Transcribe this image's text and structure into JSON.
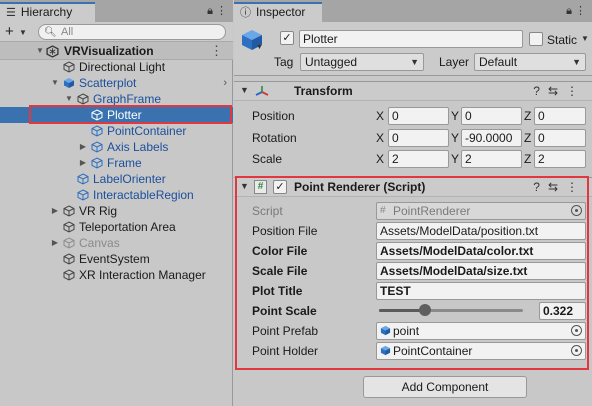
{
  "hierarchy": {
    "tab_label": "Hierarchy",
    "search_placeholder": "All",
    "scene_name": "VRVisualization",
    "items": [
      {
        "label": "Directional Light"
      },
      {
        "label": "Scatterplot"
      },
      {
        "label": "GraphFrame"
      },
      {
        "label": "Plotter"
      },
      {
        "label": "PointContainer"
      },
      {
        "label": "Axis Labels"
      },
      {
        "label": "Frame"
      },
      {
        "label": "LabelOrienter"
      },
      {
        "label": "InteractableRegion"
      },
      {
        "label": "VR Rig"
      },
      {
        "label": "Teleportation Area"
      },
      {
        "label": "Canvas"
      },
      {
        "label": "EventSystem"
      },
      {
        "label": "XR Interaction Manager"
      }
    ]
  },
  "inspector": {
    "tab_label": "Inspector",
    "object_name": "Plotter",
    "static_label": "Static",
    "tag_label": "Tag",
    "tag_value": "Untagged",
    "layer_label": "Layer",
    "layer_value": "Default",
    "transform": {
      "title": "Transform",
      "position_label": "Position",
      "rotation_label": "Rotation",
      "scale_label": "Scale",
      "x": "X",
      "y": "Y",
      "z": "Z",
      "position": [
        "0",
        "0",
        "0"
      ],
      "rotation": [
        "0",
        "-90.0000",
        "0"
      ],
      "scale": [
        "2",
        "2",
        "2"
      ]
    },
    "point_renderer": {
      "title": "Point Renderer (Script)",
      "script_label": "Script",
      "script_value": "PointRenderer",
      "position_file_label": "Position File",
      "position_file_value": "Assets/ModelData/position.txt",
      "color_file_label": "Color File",
      "color_file_value": "Assets/ModelData/color.txt",
      "scale_file_label": "Scale File",
      "scale_file_value": "Assets/ModelData/size.txt",
      "plot_title_label": "Plot Title",
      "plot_title_value": "TEST",
      "point_scale_label": "Point Scale",
      "point_scale_value": "0.322",
      "point_scale_fraction": 0.322,
      "point_prefab_label": "Point Prefab",
      "point_prefab_value": "point",
      "point_holder_label": "Point Holder",
      "point_holder_value": "PointContainer"
    },
    "add_component_label": "Add Component"
  },
  "colors": {
    "selection": "#3a72b0",
    "highlight": "#e0383e",
    "prefab_text": "#1b4f9c"
  }
}
